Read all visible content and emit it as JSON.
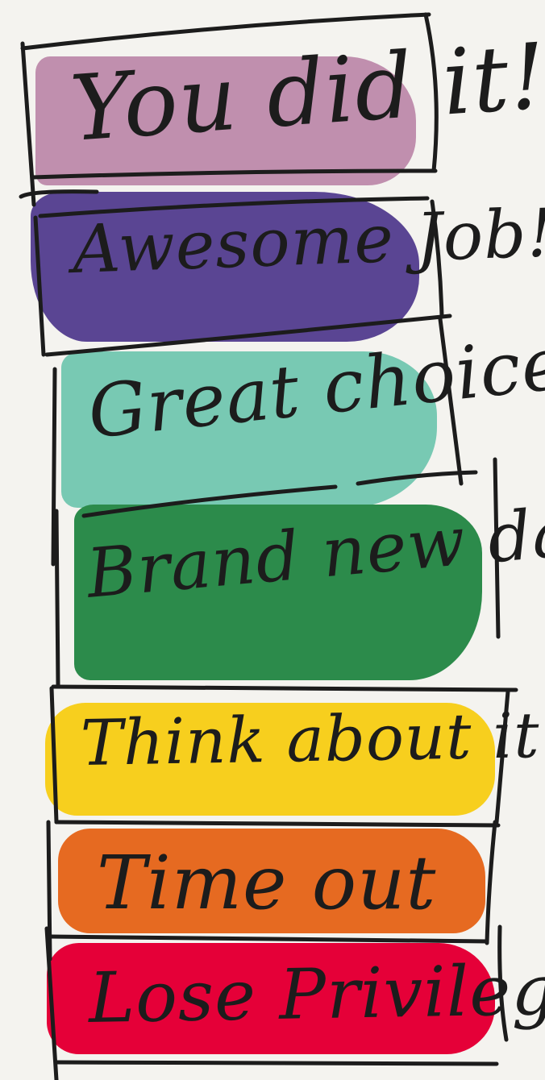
{
  "chart_items": [
    {
      "label": "You did it!",
      "color": "#c08fae"
    },
    {
      "label": "Awesome Job!",
      "color": "#5a4593"
    },
    {
      "label": "Great choices!",
      "color": "#78c9b3"
    },
    {
      "label": "Brand new day",
      "color": "#2c8b4b"
    },
    {
      "label": "Think about it",
      "color": "#f7cf1e"
    },
    {
      "label": "Time out",
      "color": "#e66a21"
    },
    {
      "label": "Lose Privilege",
      "color": "#e50038"
    }
  ],
  "ink_color": "#1c1c1c",
  "background_color": "#f4f3ef"
}
